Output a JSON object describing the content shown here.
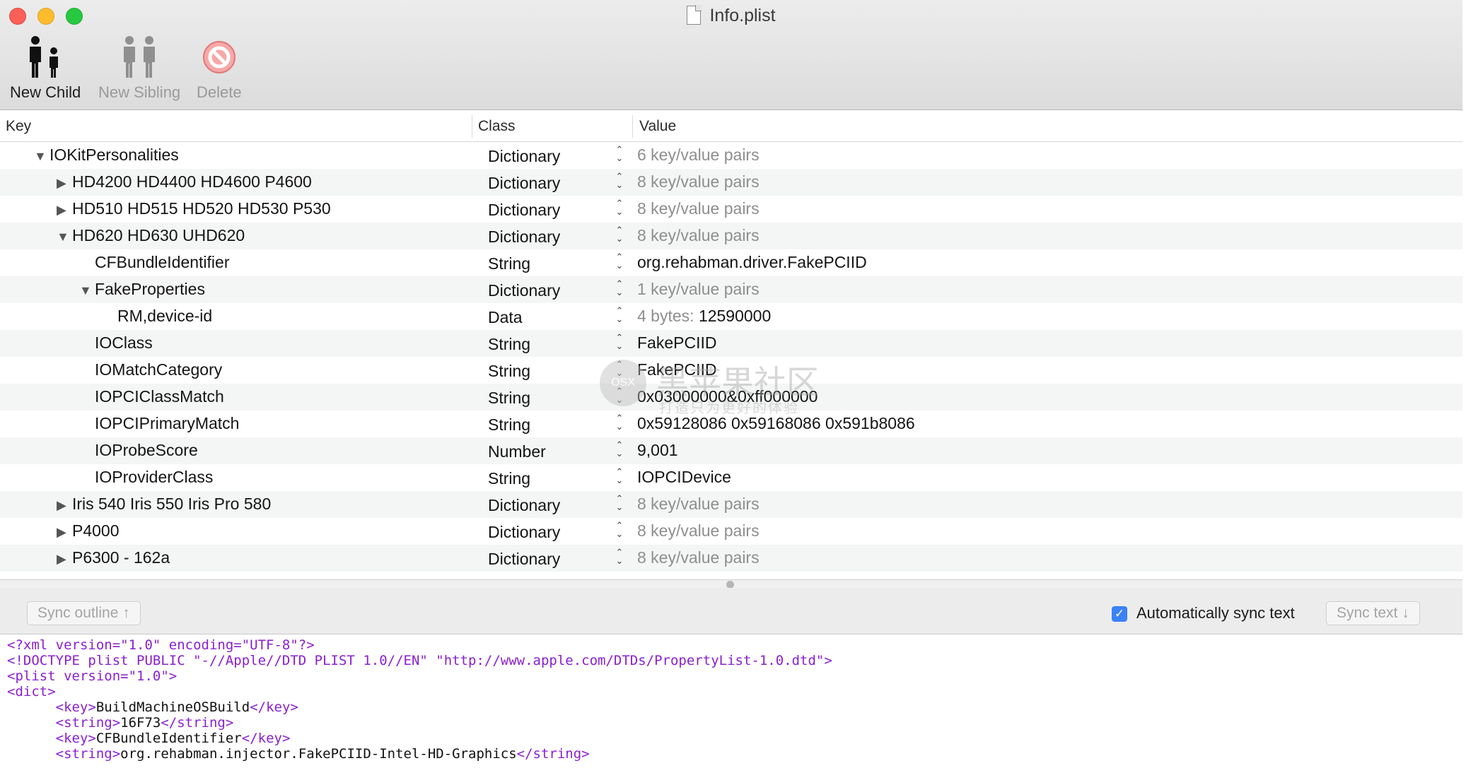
{
  "window": {
    "title": "Info.plist"
  },
  "toolbar": {
    "new_child": "New Child",
    "new_sibling": "New Sibling",
    "delete": "Delete"
  },
  "columns": {
    "key": "Key",
    "class": "Class",
    "value": "Value"
  },
  "rows": [
    {
      "key": "IOKitPersonalities",
      "tri": "▼",
      "class": "Dictionary",
      "value": "6 key/value pairs",
      "style": "muted"
    },
    {
      "key": "HD4200 HD4400 HD4600 P4600",
      "tri": "▶",
      "class": "Dictionary",
      "value": "8 key/value pairs",
      "style": "muted"
    },
    {
      "key": "HD510 HD515 HD520 HD530 P530",
      "tri": "▶",
      "class": "Dictionary",
      "value": "8 key/value pairs",
      "style": "muted"
    },
    {
      "key": "HD620 HD630 UHD620",
      "tri": "▼",
      "class": "Dictionary",
      "value": "8 key/value pairs",
      "style": "muted"
    },
    {
      "key": "CFBundleIdentifier",
      "tri": "",
      "class": "String",
      "value": "org.rehabman.driver.FakePCIID",
      "style": "dark"
    },
    {
      "key": "FakeProperties",
      "tri": "▼",
      "class": "Dictionary",
      "value": "1 key/value pairs",
      "style": "muted"
    },
    {
      "key": "RM,device-id",
      "tri": "",
      "class": "Data",
      "value_prefix": "4 bytes:",
      "value": "12590000",
      "style": "data"
    },
    {
      "key": "IOClass",
      "tri": "",
      "class": "String",
      "value": "FakePCIID",
      "style": "dark"
    },
    {
      "key": "IOMatchCategory",
      "tri": "",
      "class": "String",
      "value": "FakePCIID",
      "style": "dark"
    },
    {
      "key": "IOPCIClassMatch",
      "tri": "",
      "class": "String",
      "value": "0x03000000&0xff000000",
      "style": "dark"
    },
    {
      "key": "IOPCIPrimaryMatch",
      "tri": "",
      "class": "String",
      "value": "0x59128086 0x59168086 0x591b8086",
      "style": "dark"
    },
    {
      "key": "IOProbeScore",
      "tri": "",
      "class": "Number",
      "value": "9,001",
      "style": "dark"
    },
    {
      "key": "IOProviderClass",
      "tri": "",
      "class": "String",
      "value": "IOPCIDevice",
      "style": "dark"
    },
    {
      "key": "Iris 540 Iris 550 Iris Pro 580",
      "tri": "▶",
      "class": "Dictionary",
      "value": "8 key/value pairs",
      "style": "muted"
    },
    {
      "key": "P4000",
      "tri": "▶",
      "class": "Dictionary",
      "value": "8 key/value pairs",
      "style": "muted"
    },
    {
      "key": "P6300 - 162a",
      "tri": "▶",
      "class": "Dictionary",
      "value": "8 key/value pairs",
      "style": "muted"
    }
  ],
  "sync": {
    "sync_outline": "Sync outline ↑",
    "auto_sync": "Automatically sync text",
    "sync_text": "Sync text ↓"
  },
  "xml_lines": [
    {
      "indent": "",
      "parts": [
        {
          "t": "tag",
          "s": "<?xml version=\"1.0\" encoding=\"UTF-8\"?>"
        }
      ]
    },
    {
      "indent": "",
      "parts": [
        {
          "t": "tag",
          "s": "<!DOCTYPE plist PUBLIC \"-//Apple//DTD PLIST 1.0//EN\" \"http://www.apple.com/DTDs/PropertyList-1.0.dtd\">"
        }
      ]
    },
    {
      "indent": "",
      "parts": [
        {
          "t": "tag",
          "s": "<plist version=\"1.0\">"
        }
      ]
    },
    {
      "indent": "",
      "parts": [
        {
          "t": "tag",
          "s": "<dict>"
        }
      ]
    },
    {
      "indent": "      ",
      "parts": [
        {
          "t": "tag",
          "s": "<key>"
        },
        {
          "t": "txt",
          "s": "BuildMachineOSBuild"
        },
        {
          "t": "tag",
          "s": "</key>"
        }
      ]
    },
    {
      "indent": "      ",
      "parts": [
        {
          "t": "tag",
          "s": "<string>"
        },
        {
          "t": "txt",
          "s": "16F73"
        },
        {
          "t": "tag",
          "s": "</string>"
        }
      ]
    },
    {
      "indent": "      ",
      "parts": [
        {
          "t": "tag",
          "s": "<key>"
        },
        {
          "t": "txt",
          "s": "CFBundleIdentifier"
        },
        {
          "t": "tag",
          "s": "</key>"
        }
      ]
    },
    {
      "indent": "      ",
      "parts": [
        {
          "t": "tag",
          "s": "<string>"
        },
        {
          "t": "txt",
          "s": "org.rehabman.injector.FakePCIID-Intel-HD-Graphics"
        },
        {
          "t": "tag",
          "s": "</string>"
        }
      ]
    }
  ],
  "watermark": {
    "circle": "OSX",
    "big": "黑苹果社区",
    "small": "打造只为更好的体验"
  },
  "colors": {
    "accent": "#3a82f7",
    "close": "#fc5f57",
    "minimize": "#fdbc2e",
    "zoom": "#27c940",
    "xml_tag": "#8a1fd1"
  }
}
